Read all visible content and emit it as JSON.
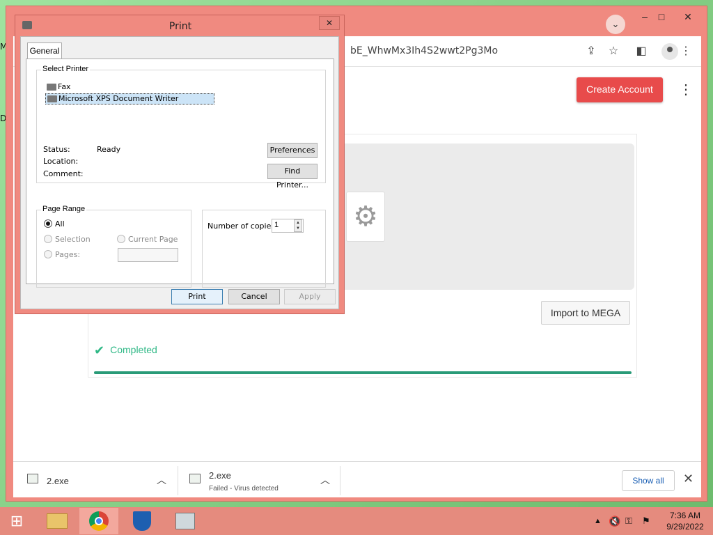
{
  "desktop": {
    "fragments": [
      "M",
      "D"
    ]
  },
  "browser": {
    "url_fragment": "bE_WhwMx3Ih4S2wwt2Pg3Mo",
    "window_controls": {
      "minimize": "‒",
      "maximize": "□",
      "close": "✕"
    },
    "create_account": "Create Account",
    "import_button": "Import to MEGA",
    "status_text": "Completed",
    "downloads": [
      {
        "name": "2.exe",
        "status": ""
      },
      {
        "name": "2.exe",
        "status": "Failed - Virus detected"
      }
    ],
    "show_all": "Show all"
  },
  "print_dialog": {
    "title": "Print",
    "tab": "General",
    "select_printer_label": "Select Printer",
    "printers": [
      "Fax",
      "Microsoft XPS Document Writer"
    ],
    "selected_printer": "Microsoft XPS Document Writer",
    "status_label": "Status:",
    "status_value": "Ready",
    "location_label": "Location:",
    "comment_label": "Comment:",
    "preferences_button": "Preferences",
    "find_printer_button": "Find Printer...",
    "page_range_label": "Page Range",
    "range_all": "All",
    "range_selection": "Selection",
    "range_current": "Current Page",
    "range_pages": "Pages:",
    "copies_label": "Number of copies:",
    "copies_value": "1",
    "print_button": "Print",
    "cancel_button": "Cancel",
    "apply_button": "Apply"
  },
  "taskbar": {
    "time": "7:36 AM",
    "date": "9/29/2022"
  },
  "colors": {
    "accent_red": "#e84b4b",
    "success_green": "#2fb886",
    "titlebar": "#f08a80"
  }
}
